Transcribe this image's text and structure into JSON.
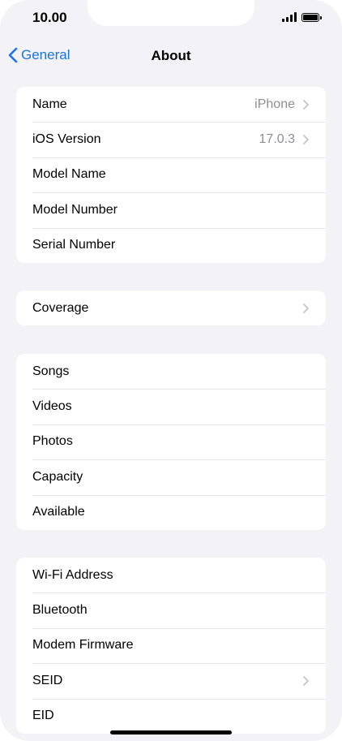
{
  "status": {
    "time": "10.00"
  },
  "nav": {
    "back_label": "General",
    "title": "About"
  },
  "groups": [
    {
      "rows": [
        {
          "label": "Name",
          "value": "iPhone",
          "chevron": true
        },
        {
          "label": "iOS Version",
          "value": "17.0.3",
          "chevron": true
        },
        {
          "label": "Model Name",
          "value": "",
          "chevron": false
        },
        {
          "label": "Model Number",
          "value": "",
          "chevron": false
        },
        {
          "label": "Serial Number",
          "value": "",
          "chevron": false
        }
      ]
    },
    {
      "rows": [
        {
          "label": "Coverage",
          "value": "",
          "chevron": true
        }
      ]
    },
    {
      "rows": [
        {
          "label": "Songs",
          "value": "",
          "chevron": false
        },
        {
          "label": "Videos",
          "value": "",
          "chevron": false
        },
        {
          "label": "Photos",
          "value": "",
          "chevron": false
        },
        {
          "label": "Capacity",
          "value": "",
          "chevron": false
        },
        {
          "label": "Available",
          "value": "",
          "chevron": false
        }
      ]
    },
    {
      "rows": [
        {
          "label": "Wi-Fi Address",
          "value": "",
          "chevron": false
        },
        {
          "label": "Bluetooth",
          "value": "",
          "chevron": false
        },
        {
          "label": "Modem Firmware",
          "value": "",
          "chevron": false
        },
        {
          "label": "SEID",
          "value": "",
          "chevron": true
        },
        {
          "label": "EID",
          "value": "",
          "chevron": false
        }
      ]
    }
  ],
  "colors": {
    "accent": "#1a73e8",
    "background": "#f2f2f7",
    "secondary_text": "#8e8e93"
  },
  "icons": {
    "back": "chevron-left-icon",
    "row_disclosure": "chevron-right-icon",
    "signal": "cellular-signal-icon",
    "battery": "battery-icon"
  }
}
